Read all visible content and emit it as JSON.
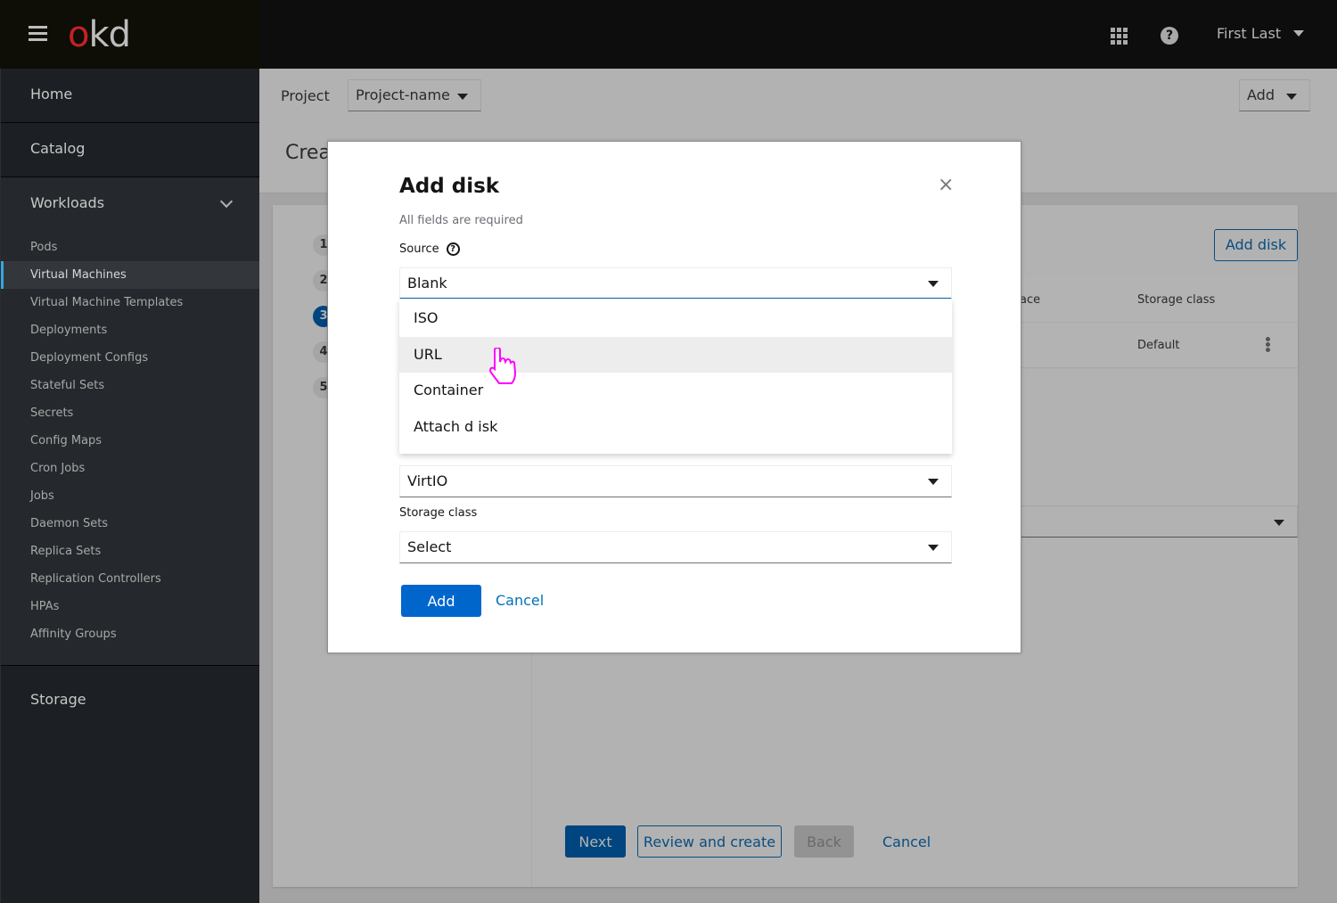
{
  "masthead": {
    "brand_o": "o",
    "brand_kd": "kd",
    "icons": [
      "hamburger-icon",
      "app-launcher-icon",
      "help-icon"
    ],
    "help_glyph": "?",
    "user_name": "First Last"
  },
  "sidebar": {
    "home": "Home",
    "catalog": "Catalog",
    "workloads": {
      "label": "Workloads",
      "items": [
        {
          "label": "Pods",
          "active": false
        },
        {
          "label": "Virtual Machines",
          "active": true
        },
        {
          "label": "Virtual Machine Templates",
          "active": false
        },
        {
          "label": "Deployments",
          "active": false
        },
        {
          "label": "Deployment Configs",
          "active": false
        },
        {
          "label": "Stateful Sets",
          "active": false
        },
        {
          "label": "Secrets",
          "active": false
        },
        {
          "label": "Config Maps",
          "active": false
        },
        {
          "label": "Cron Jobs",
          "active": false
        },
        {
          "label": "Jobs",
          "active": false
        },
        {
          "label": "Daemon Sets",
          "active": false
        },
        {
          "label": "Replica Sets",
          "active": false
        },
        {
          "label": "Replication Controllers",
          "active": false
        },
        {
          "label": "HPAs",
          "active": false
        },
        {
          "label": "Affinity Groups",
          "active": false
        }
      ]
    },
    "storage": "Storage"
  },
  "toolbar": {
    "project_label": "Project",
    "project_value": "Project-name",
    "add_label": "Add"
  },
  "page": {
    "title": "Crea",
    "wizard_steps": [
      "1",
      "2",
      "3",
      "4",
      "5"
    ],
    "current_step": "3",
    "add_disk_button": "Add disk",
    "table": {
      "headers": [
        "ace",
        "Storage class"
      ],
      "rows": [
        {
          "storage_class": "Default"
        }
      ]
    },
    "footer": {
      "next": "Next",
      "review": "Review and create",
      "back": "Back",
      "cancel": "Cancel"
    }
  },
  "modal": {
    "title": "Add disk",
    "close_glyph": "×",
    "subtitle": "All fields are required",
    "source_label": "Source",
    "source_value": "Blank",
    "source_options": [
      "ISO",
      "URL",
      "Container",
      "Attach d isk"
    ],
    "hovered_option": "URL",
    "interface_value": "VirtIO",
    "storage_class_label": "Storage class",
    "storage_class_value": "Select",
    "add_button": "Add",
    "cancel_button": "Cancel"
  },
  "colors": {
    "primary": "#0066cc",
    "link": "#0073b7",
    "focus_border": "#0066a1",
    "active_nav_accent": "#39a5dc",
    "brand_red": "#c42127"
  }
}
